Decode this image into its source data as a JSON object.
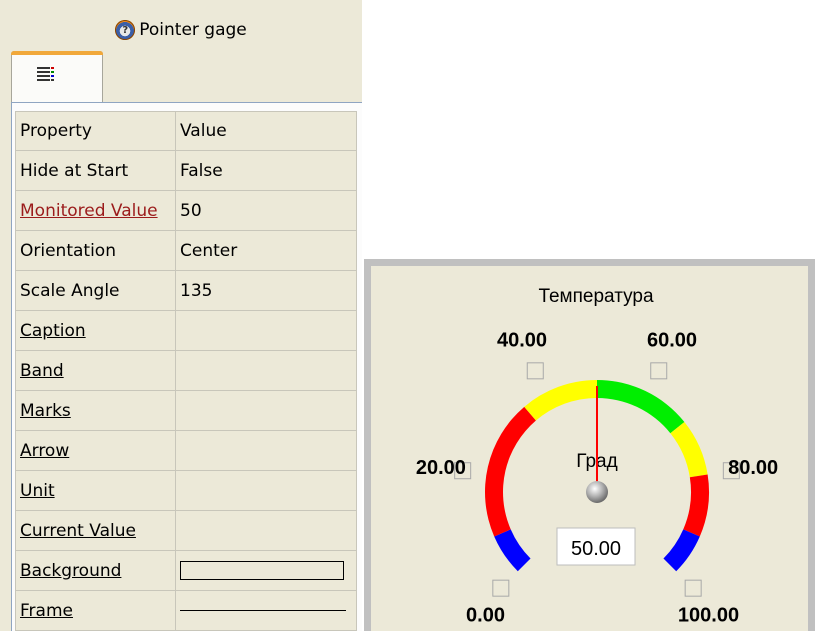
{
  "panel": {
    "title": "Pointer gage",
    "title_icon": "pointer-gage-icon",
    "tab_icon": "property-list-icon"
  },
  "table": {
    "headers": {
      "property": "Property",
      "value": "Value"
    },
    "rows": [
      {
        "name": "Hide at Start",
        "value": "False",
        "style": "plain"
      },
      {
        "name": "Monitored Value",
        "value": "50",
        "style": "red-link"
      },
      {
        "name": "Orientation",
        "value": "Center",
        "style": "plain"
      },
      {
        "name": "Scale Angle",
        "value": "135",
        "style": "plain"
      },
      {
        "name": "Caption",
        "value": "",
        "style": "link"
      },
      {
        "name": "Band",
        "value": "",
        "style": "link"
      },
      {
        "name": "Marks",
        "value": "",
        "style": "link"
      },
      {
        "name": "Arrow",
        "value": "",
        "style": "link"
      },
      {
        "name": "Unit",
        "value": "",
        "style": "link"
      },
      {
        "name": "Current Value",
        "value": "",
        "style": "link"
      },
      {
        "name": "Background",
        "value": "",
        "style": "link",
        "swatch": "box"
      },
      {
        "name": "Frame",
        "value": "",
        "style": "link",
        "swatch": "line"
      }
    ]
  },
  "gauge": {
    "caption": "Температура",
    "unit": "Град",
    "current_value_text": "50.00",
    "value": 50,
    "min": 0,
    "max": 100,
    "scale_angle": 135,
    "labels": [
      "0.00",
      "20.00",
      "40.00",
      "60.00",
      "80.00",
      "100.00"
    ],
    "bands": [
      {
        "from": 0,
        "to": 8,
        "color": "#0000ff"
      },
      {
        "from": 8,
        "to": 35,
        "color": "#ff0000"
      },
      {
        "from": 35,
        "to": 50,
        "color": "#ffff00"
      },
      {
        "from": 50,
        "to": 69,
        "color": "#00ee00"
      },
      {
        "from": 69,
        "to": 80,
        "color": "#ffff00"
      },
      {
        "from": 80,
        "to": 92,
        "color": "#ff0000"
      },
      {
        "from": 92,
        "to": 100,
        "color": "#0000ff"
      }
    ],
    "needle_color": "#ff0000"
  }
}
